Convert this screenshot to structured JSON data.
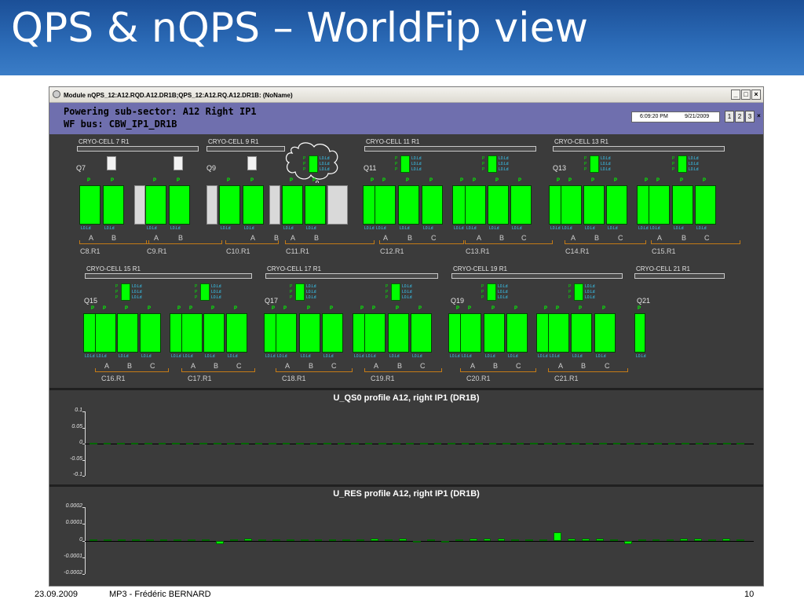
{
  "slide": {
    "title": "QPS & nQPS – WorldFip view",
    "footer_date": "23.09.2009",
    "footer_author": "MP3 - Frédéric BERNARD",
    "page": "10"
  },
  "window": {
    "title": "Module nQPS_12:A12.RQD.A12.DR1B;QPS_12:A12.RQ.A12.DR1B: (NoName)",
    "min": "_",
    "max": "□",
    "close": "×"
  },
  "header": {
    "line1": "Powering sub-sector: A12 Right IP1",
    "line2": "WF bus: CBW_IP1_DR1B",
    "time": "6:09:20 PM",
    "date": "9/21/2009",
    "page_buttons": [
      "1",
      "2",
      "3"
    ],
    "close": "×"
  },
  "row1": {
    "cells": [
      "CRYO-CELL 7 R1",
      "CRYO-CELL 9 R1",
      "CRYO-CELL 11 R1",
      "CRYO-CELL 13 R1"
    ],
    "quads": [
      "Q7",
      "Q9",
      "Q11",
      "Q13"
    ],
    "halfcells": [
      "C8.R1",
      "C9.R1",
      "C10.R1",
      "C11.R1",
      "C12.R1",
      "C13.R1",
      "C14.R1",
      "C15.R1"
    ]
  },
  "row2": {
    "cells": [
      "CRYO-CELL 15 R1",
      "CRYO-CELL 17 R1",
      "CRYO-CELL 19 R1",
      "CRYO-CELL 21 R1"
    ],
    "quads": [
      "Q15",
      "Q17",
      "Q19",
      "Q21"
    ],
    "halfcells": [
      "C16.R1",
      "C17.R1",
      "C18.R1",
      "C19.R1",
      "C20.R1",
      "C21.R1"
    ]
  },
  "labels": {
    "p": "P",
    "lo": "L0.Ld",
    "a": "A",
    "b": "B",
    "c": "C"
  },
  "chart_data": [
    {
      "type": "bar",
      "title": "U_QS0 profile A12, right IP1 (DR1B)",
      "ylim": [
        -0.1,
        0.1
      ],
      "yticks": [
        "0.1",
        "0.05",
        "0",
        "-0.05",
        "-0.1"
      ],
      "values": [
        0,
        0,
        0.001,
        0,
        0.001,
        0,
        0,
        0.001,
        0,
        0,
        0,
        0.001,
        0,
        0,
        0,
        0,
        0,
        0,
        0.001,
        0,
        0,
        0,
        0,
        0.001,
        0,
        0,
        0,
        0,
        0.001,
        0,
        0.001,
        0,
        0.001,
        0.001,
        0,
        0,
        0.001,
        0,
        0.001,
        0,
        0.001,
        0,
        0,
        0,
        0,
        0.001,
        0,
        0.001
      ]
    },
    {
      "type": "bar",
      "title": "U_RES profile A12, right IP1 (DR1B)",
      "ylim": [
        -0.0002,
        0.0002
      ],
      "yticks": [
        "0.0002",
        "0.0001",
        "0",
        "-0.0001",
        "-0.0002"
      ],
      "values": [
        0,
        0,
        0,
        0,
        0,
        0,
        0,
        0,
        0,
        -2e-05,
        0,
        1e-05,
        0,
        0,
        0,
        0,
        0,
        0,
        0,
        0,
        1e-05,
        0,
        1e-05,
        -1e-05,
        0,
        -1e-05,
        0,
        1e-05,
        1e-05,
        1e-05,
        0,
        0,
        0,
        5e-05,
        1e-05,
        1e-05,
        1e-05,
        0,
        -2e-05,
        0,
        0,
        0,
        1e-05,
        1e-05,
        0,
        1e-05,
        0
      ]
    }
  ]
}
